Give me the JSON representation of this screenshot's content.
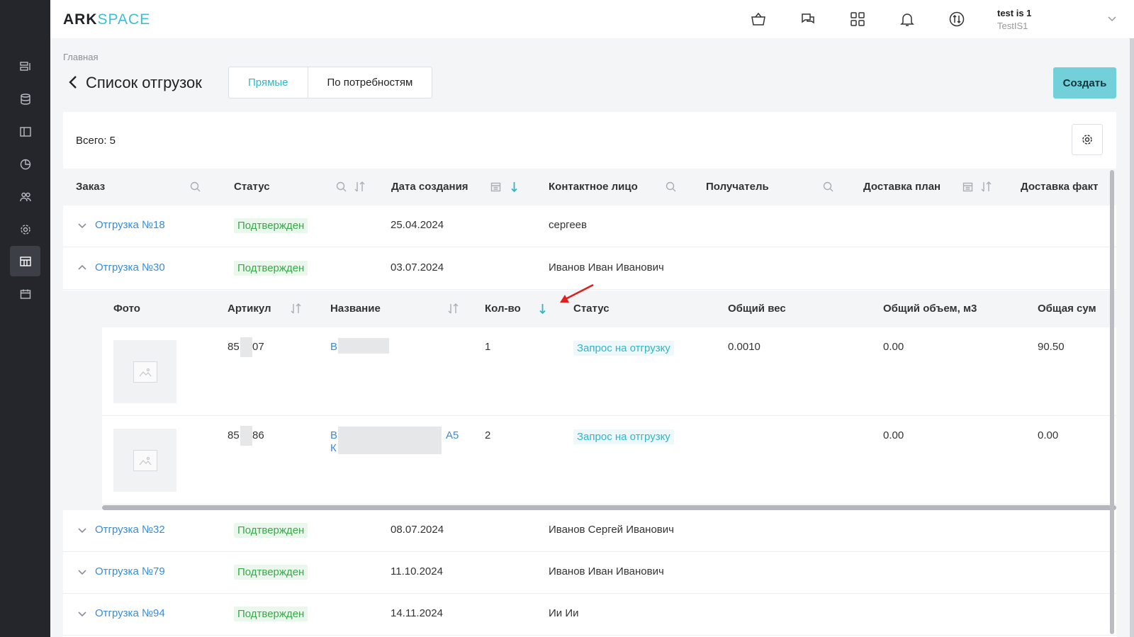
{
  "logo": {
    "part1": "ARK",
    "part2": "SPACE"
  },
  "header": {
    "icons": [
      "basket-icon",
      "chat-icon",
      "apps-grid-icon",
      "bell-icon",
      "exchange-icon"
    ],
    "user_name": "test is 1",
    "user_sub": "TestIS1"
  },
  "sidebar": {
    "items": [
      "list-icon",
      "database-icon",
      "panel-icon",
      "chart-icon",
      "users-icon",
      "gear-icon",
      "shipments-icon",
      "calendar-icon"
    ],
    "active_index": 6
  },
  "breadcrumb": "Главная",
  "page_title": "Список отгрузок",
  "tabs": [
    {
      "label": "Прямые",
      "active": true
    },
    {
      "label": "По потребностям",
      "active": false
    }
  ],
  "create_label": "Создать",
  "total_label": "Всего: 5",
  "columns": {
    "order": "Заказ",
    "status": "Статус",
    "created": "Дата создания",
    "contact": "Контактное лицо",
    "recipient": "Получатель",
    "delivery_plan": "Доставка план",
    "delivery_fact": "Доставка факт"
  },
  "rows": [
    {
      "order": "Отгрузка №18",
      "status": "Подтвержден",
      "date": "25.04.2024",
      "contact": "сергеев",
      "expanded": false
    },
    {
      "order": "Отгрузка №30",
      "status": "Подтвержден",
      "date": "03.07.2024",
      "contact": "Иванов Иван Иванович",
      "expanded": true
    },
    {
      "order": "Отгрузка №32",
      "status": "Подтвержден",
      "date": "08.07.2024",
      "contact": "Иванов Сергей Иванович",
      "expanded": false
    },
    {
      "order": "Отгрузка №79",
      "status": "Подтвержден",
      "date": "11.10.2024",
      "contact": "Иванов Иван Иванович",
      "expanded": false
    },
    {
      "order": "Отгрузка №94",
      "status": "Подтвержден",
      "date": "14.11.2024",
      "contact": "Ии Ии",
      "expanded": false
    }
  ],
  "sub_columns": {
    "photo": "Фото",
    "article": "Артикул",
    "name": "Название",
    "qty": "Кол-во",
    "status": "Статус",
    "weight": "Общий вес",
    "volume": "Общий объем, м3",
    "sum": "Общая сум"
  },
  "sub_rows": [
    {
      "article_a": "85",
      "article_b": "07",
      "name_a": "В",
      "name_b": "",
      "name_line2": "",
      "qty": "1",
      "status": "Запрос на отгрузку",
      "weight": "0.0010",
      "volume": "0.00",
      "sum": "90.50"
    },
    {
      "article_a": "85",
      "article_b": "86",
      "name_a": "В",
      "name_b": "А5",
      "name_line2": "К",
      "qty": "2",
      "status": "Запрос на отгрузку",
      "weight": "",
      "volume": "0.00",
      "sum": "0.00"
    }
  ],
  "colors": {
    "accent": "#2fb7c7",
    "link": "#3a8bd6",
    "status_green": "#3aa84a",
    "sidebar": "#24262b",
    "annotation_arrow": "#e0201e"
  }
}
